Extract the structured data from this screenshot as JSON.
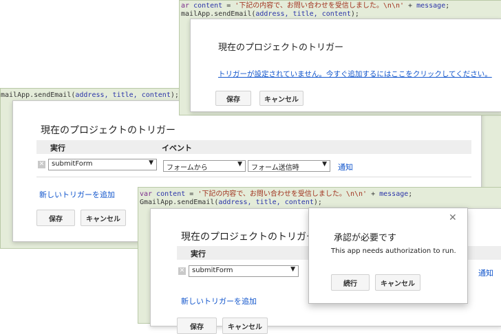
{
  "code": {
    "line1_var": "var ",
    "line1_name": "content",
    "line1_eq": " = ",
    "line1_str": "'下記の内容で、お問い合わせを受信しました。\\n\\n'",
    "line1_plus": " + ",
    "line1_msg": "message",
    "line1_semi": ";",
    "line2_call": "mailApp.sendEmail(",
    "line2_call_full": "GmailApp.sendEmail(",
    "line2_call_clip": "mailApp.sendEmail(",
    "line2_args": "address, title, content",
    "line2_end": ");",
    "line1_clip": "ar ",
    "line2_call_clip2": "GmailApp.sendEmail("
  },
  "dialog_top": {
    "title": "現在のプロジェクトのトリガー",
    "no_trigger_link": "トリガーが設定されていません。今すぐ追加するにはここをクリックしてください。",
    "save": "保存",
    "cancel": "キャンセル"
  },
  "dialog_mid": {
    "title": "現在のプロジェクトのトリガー",
    "col_run": "実行",
    "col_event": "イベント",
    "function_select": "submitForm",
    "source_select": "フォームから",
    "event_select": "フォーム送信時",
    "notify_link": "通知",
    "add_trigger_link": "新しいトリガーを追加",
    "save": "保存",
    "cancel": "キャンセル"
  },
  "dialog_bottom": {
    "title": "現在のプロジェクトのトリガー",
    "col_run": "実行",
    "function_select": "submitForm",
    "notify_link": "通知",
    "add_trigger_link": "新しいトリガーを追加",
    "save": "保存",
    "cancel": "キャンセル"
  },
  "auth_dialog": {
    "title": "承認が必要です",
    "message": "This app needs authorization to run.",
    "continue": "続行",
    "cancel": "キャンセル"
  },
  "colors": {
    "panel_bg": "#e4ecd9",
    "link": "#1155cc",
    "string": "#a0321e",
    "ident": "#2a33a8"
  },
  "icons": {
    "close": "close-icon",
    "remove": "remove-trigger-icon",
    "dropdown": "dropdown-arrow-icon"
  }
}
